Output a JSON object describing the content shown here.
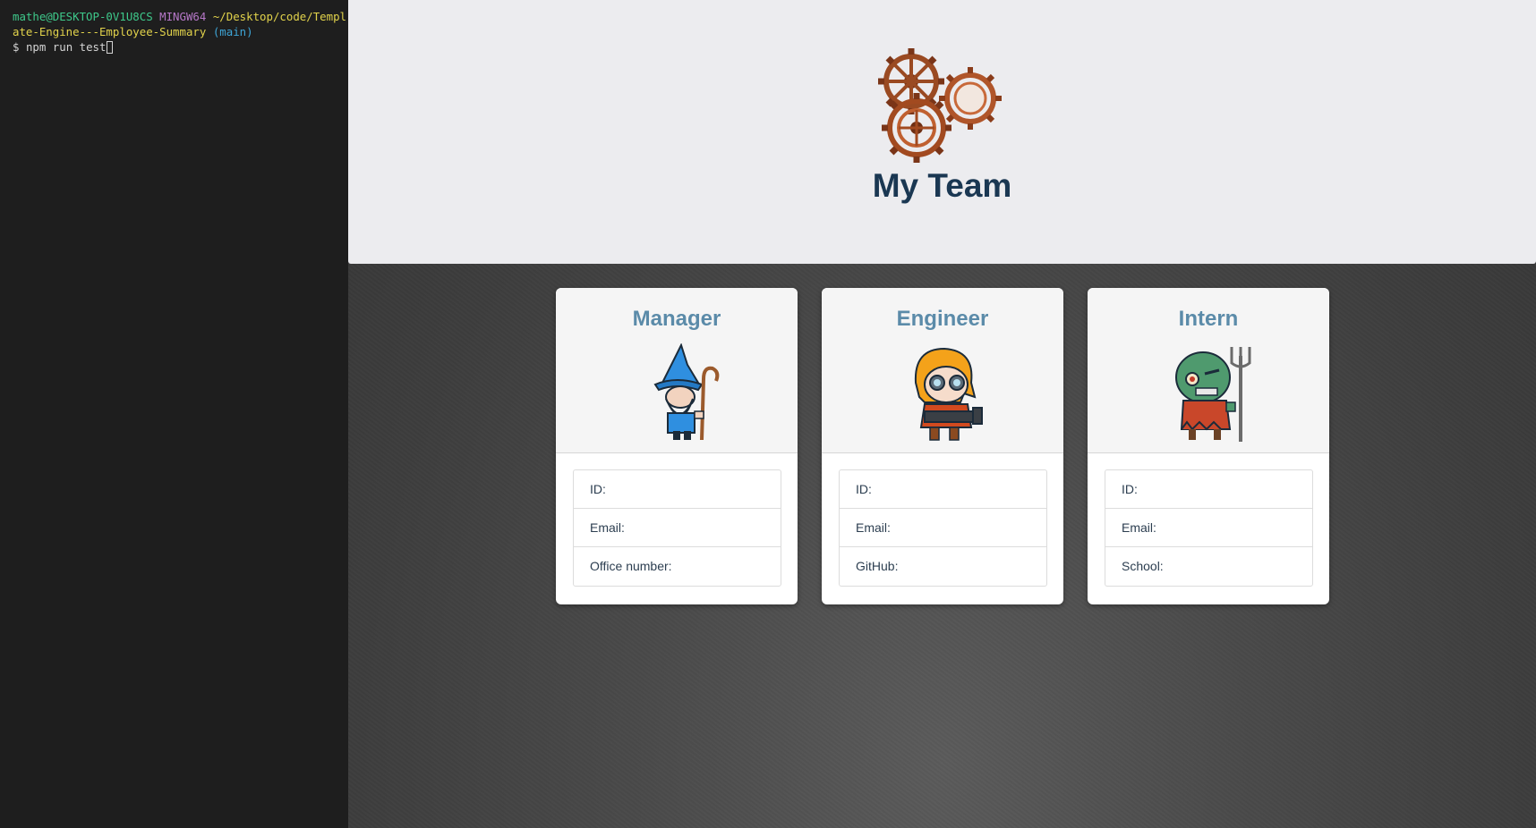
{
  "terminal": {
    "user_host": "mathe@DESKTOP-0V1U8CS",
    "shell": "MINGW64",
    "path_line1": "~/Desktop/code/Templ",
    "path_line2": "ate-Engine---Employee-Summary",
    "branch": "(main)",
    "prompt": "$",
    "command": "npm run test"
  },
  "header": {
    "title": "My Team",
    "logo_icon": "gears-icon"
  },
  "cards": [
    {
      "title": "Manager",
      "avatar_icon": "wizard-avatar-icon",
      "fields": [
        {
          "label": "ID:"
        },
        {
          "label": "Email:"
        },
        {
          "label": "Office number:"
        }
      ]
    },
    {
      "title": "Engineer",
      "avatar_icon": "goggles-engineer-avatar-icon",
      "fields": [
        {
          "label": "ID:"
        },
        {
          "label": "Email:"
        },
        {
          "label": "GitHub:"
        }
      ]
    },
    {
      "title": "Intern",
      "avatar_icon": "zombie-pitchfork-avatar-icon",
      "fields": [
        {
          "label": "ID:"
        },
        {
          "label": "Email:"
        },
        {
          "label": "School:"
        }
      ]
    }
  ],
  "colors": {
    "title": "#1a3752",
    "card_title": "#5b8ba9",
    "hero_bg": "#ececef",
    "terminal_bg": "#1e1e1e",
    "gear": "#a0522d"
  }
}
